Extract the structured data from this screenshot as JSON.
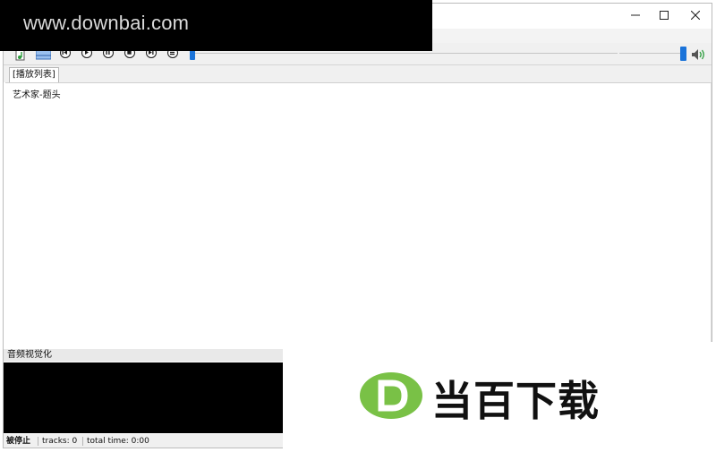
{
  "window": {
    "controls": {
      "minimize_icon": "minimize-icon",
      "maximize_icon": "maximize-icon",
      "close_icon": "close-icon"
    }
  },
  "toolbar": {
    "icons": [
      "add-file-icon",
      "playlist-icon",
      "previous-icon",
      "play-icon",
      "pause-icon",
      "stop-icon",
      "next-icon",
      "menu-icon",
      "volume-icon"
    ],
    "seek_slider_position": 0.0,
    "volume_slider_position": 1.0
  },
  "tabs": [
    {
      "label": "[播放列表]"
    }
  ],
  "playlist": {
    "items": [
      {
        "label": "艺术家-题头"
      }
    ]
  },
  "visualizer": {
    "label": "音频视觉化"
  },
  "status": {
    "state": "被停止",
    "tracks": "tracks: 0",
    "total_time": "total time: 0:00"
  },
  "watermarks": {
    "top": "www.downbai.com",
    "logo_letter": "D",
    "logo_text": "当百下载"
  },
  "colors": {
    "accent": "#1a73d9",
    "logo_green": "#79c146"
  }
}
